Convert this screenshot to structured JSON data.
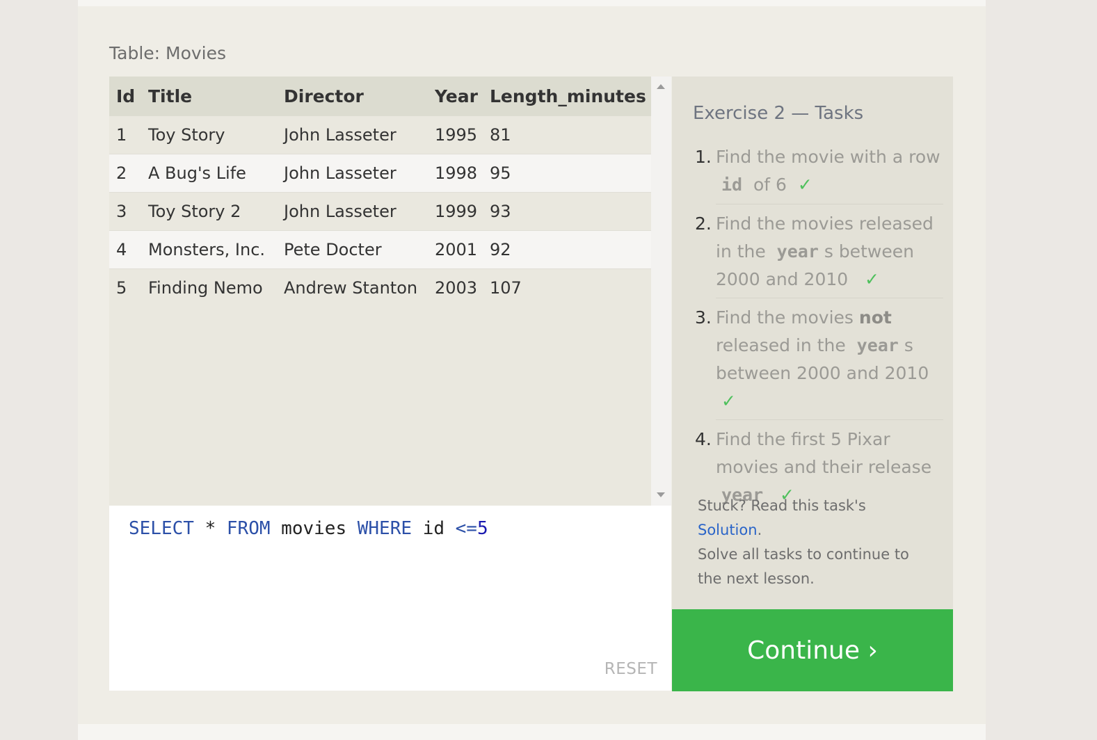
{
  "table": {
    "caption": "Table: Movies",
    "columns": [
      "Id",
      "Title",
      "Director",
      "Year",
      "Length_minutes"
    ],
    "rows": [
      [
        "1",
        "Toy Story",
        "John Lasseter",
        "1995",
        "81"
      ],
      [
        "2",
        "A Bug's Life",
        "John Lasseter",
        "1998",
        "95"
      ],
      [
        "3",
        "Toy Story 2",
        "John Lasseter",
        "1999",
        "93"
      ],
      [
        "4",
        "Monsters, Inc.",
        "Pete Docter",
        "2001",
        "92"
      ],
      [
        "5",
        "Finding Nemo",
        "Andrew Stanton",
        "2003",
        "107"
      ]
    ]
  },
  "editor": {
    "query": {
      "select": "SELECT",
      "star": "*",
      "from": "FROM",
      "table": "movies",
      "where": "WHERE",
      "col": "id",
      "op": "<=",
      "val": "5"
    },
    "reset_label": "RESET"
  },
  "tasks": {
    "title": "Exercise 2 — Tasks",
    "items": [
      {
        "num": "1.",
        "a": "Find the movie with a row",
        "code": "id",
        "b": "of 6",
        "check": "✓"
      },
      {
        "num": "2.",
        "a": "Find the movies released in the",
        "code": "year",
        "b": "s between 2000 and 2010",
        "check": "✓"
      },
      {
        "num": "3.",
        "a": "Find the movies",
        "bold": "not",
        "a2": "released in the",
        "code": "year",
        "b": "s between 2000 and 2010",
        "check": "✓"
      },
      {
        "num": "4.",
        "a": "Find the first 5 Pixar movies and their release",
        "code": "year",
        "check": "✓"
      }
    ],
    "stuck_prefix": "Stuck? Read this task's",
    "solution_link": "Solution",
    "stuck_period": ".",
    "stuck_suffix": "Solve all tasks to continue to the next lesson."
  },
  "continue_label": "Continue ›",
  "colors": {
    "continue_bg": "#3ab54a",
    "check": "#4ec05c",
    "link": "#2a64c8",
    "keyword": "#2c50a8"
  }
}
